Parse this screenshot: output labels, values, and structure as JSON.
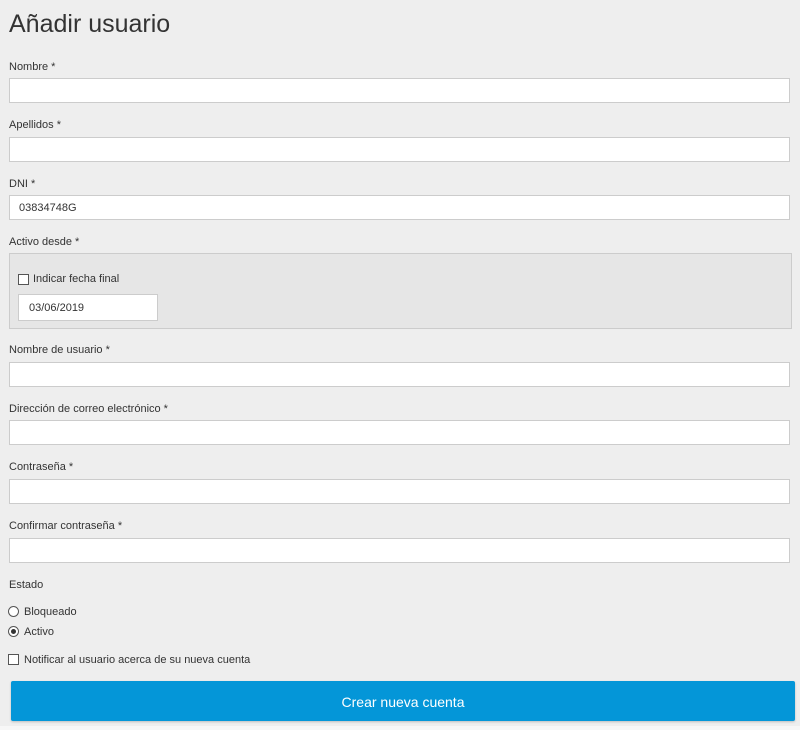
{
  "page": {
    "title": "Añadir usuario"
  },
  "form": {
    "nombre": {
      "label": "Nombre *",
      "value": ""
    },
    "apellidos": {
      "label": "Apellidos *",
      "value": ""
    },
    "dni": {
      "label": "DNI *",
      "value": "03834748G"
    },
    "activo_desde": {
      "label": "Activo desde *",
      "end_date_checkbox_label": "Indicar fecha final",
      "end_date_checked": false,
      "date_value": "03/06/2019"
    },
    "usuario": {
      "label": "Nombre de usuario *",
      "value": ""
    },
    "email": {
      "label": "Dirección de correo electrónico *",
      "value": ""
    },
    "password": {
      "label": "Contraseña *",
      "value": ""
    },
    "password_confirm": {
      "label": "Confirmar contraseña *",
      "value": ""
    },
    "estado": {
      "label": "Estado",
      "options": [
        {
          "label": "Bloqueado",
          "selected": false
        },
        {
          "label": "Activo",
          "selected": true
        }
      ]
    },
    "notify": {
      "label": "Notificar al usuario acerca de su nueva cuenta",
      "checked": false
    },
    "submit_label": "Crear nueva cuenta"
  },
  "colors": {
    "background": "#eeeeee",
    "button": "#0496d8",
    "button_text": "#ffffff"
  }
}
